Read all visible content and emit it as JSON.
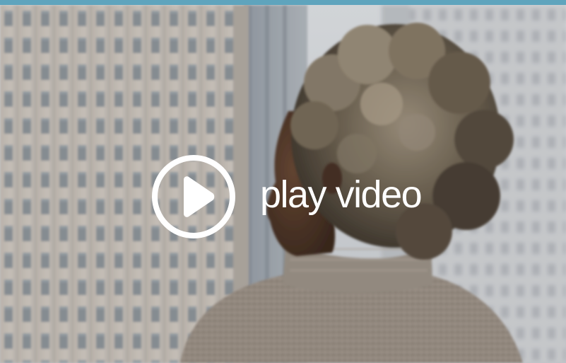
{
  "video": {
    "play_label": "play video",
    "play_icon": "play-circle-icon"
  },
  "colors": {
    "accent": "#5fa4bd",
    "overlay_text": "#ffffff"
  }
}
